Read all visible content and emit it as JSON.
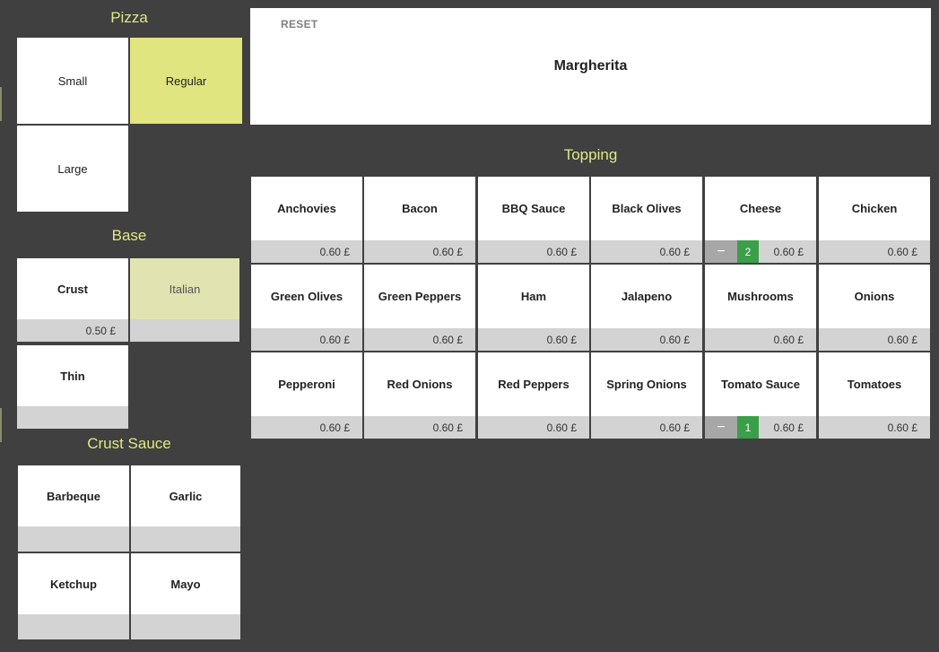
{
  "pizza": {
    "title": "Pizza",
    "sizes": [
      {
        "label": "Small",
        "selected": false
      },
      {
        "label": "Regular",
        "selected": true
      },
      {
        "label": "Large",
        "selected": false
      }
    ]
  },
  "base": {
    "title": "Base",
    "items": [
      {
        "label": "Crust",
        "price": "0.50 £",
        "selected": false
      },
      {
        "label": "Italian",
        "price": "",
        "selected": true
      },
      {
        "label": "Thin",
        "price": "",
        "selected": false
      }
    ]
  },
  "crust_sauce": {
    "title": "Crust Sauce",
    "items": [
      {
        "label": "Barbeque",
        "price": ""
      },
      {
        "label": "Garlic",
        "price": ""
      },
      {
        "label": "Ketchup",
        "price": ""
      },
      {
        "label": "Mayo",
        "price": ""
      }
    ]
  },
  "header": {
    "reset_label": "RESET",
    "pizza_name": "Margherita"
  },
  "topping": {
    "title": "Topping",
    "minus_symbol": "−",
    "items": [
      {
        "label": "Anchovies",
        "price": "0.60 £",
        "count": null
      },
      {
        "label": "Bacon",
        "price": "0.60 £",
        "count": null
      },
      {
        "label": "BBQ Sauce",
        "price": "0.60 £",
        "count": null
      },
      {
        "label": "Black Olives",
        "price": "0.60 £",
        "count": null
      },
      {
        "label": "Cheese",
        "price": "0.60 £",
        "count": "2"
      },
      {
        "label": "Chicken",
        "price": "0.60 £",
        "count": null
      },
      {
        "label": "Green Olives",
        "price": "0.60 £",
        "count": null
      },
      {
        "label": "Green Peppers",
        "price": "0.60 £",
        "count": null
      },
      {
        "label": "Ham",
        "price": "0.60 £",
        "count": null
      },
      {
        "label": "Jalapeno",
        "price": "0.60 £",
        "count": null
      },
      {
        "label": "Mushrooms",
        "price": "0.60 £",
        "count": null
      },
      {
        "label": "Onions",
        "price": "0.60 £",
        "count": null
      },
      {
        "label": "Pepperoni",
        "price": "0.60 £",
        "count": null
      },
      {
        "label": "Red Onions",
        "price": "0.60 £",
        "count": null
      },
      {
        "label": "Red Peppers",
        "price": "0.60 £",
        "count": null
      },
      {
        "label": "Spring Onions",
        "price": "0.60 £",
        "count": null
      },
      {
        "label": "Tomato Sauce",
        "price": "0.60 £",
        "count": "1"
      },
      {
        "label": "Tomatoes",
        "price": "0.60 £",
        "count": null
      }
    ]
  },
  "colors": {
    "background": "#3f403f",
    "accent_text": "#e2e785",
    "selected_strong": "#e1e57f",
    "selected_soft": "#e1e4b1",
    "footer": "#d3d3d3",
    "count_badge": "#3a9f48"
  }
}
